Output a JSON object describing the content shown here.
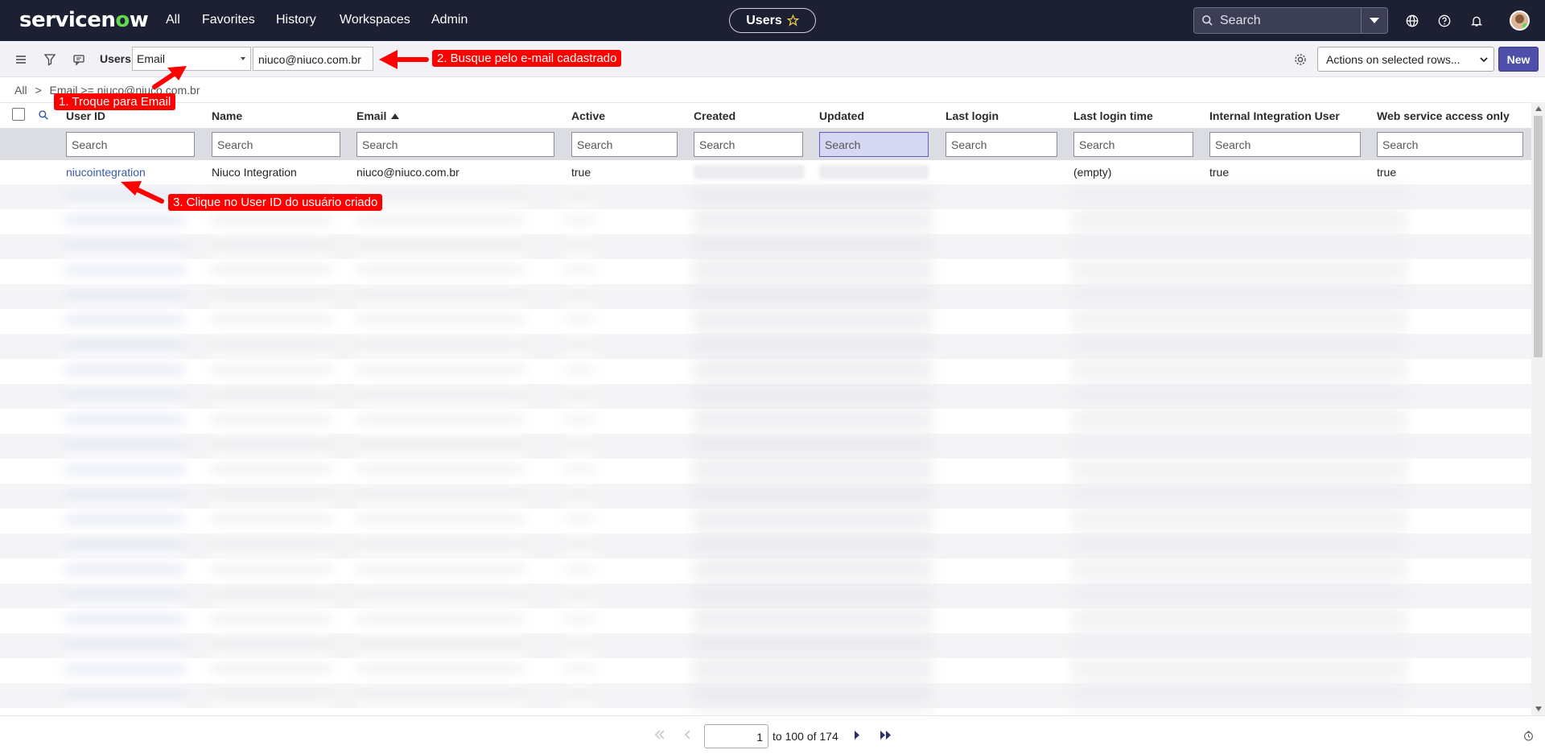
{
  "topbar": {
    "logo_text": "servicenow",
    "nav": [
      "All",
      "Favorites",
      "History",
      "Workspaces",
      "Admin"
    ],
    "context_pill": "Users",
    "search_label": "Search"
  },
  "toolbar": {
    "list_title": "Users",
    "field_select": "Email",
    "field_value": "niuco@niuco.com.br",
    "actions_select": "Actions on selected rows...",
    "new_button": "New"
  },
  "breadcrumb": {
    "all": "All",
    "separator": ">",
    "condition": "Email >= niuco@niuco.com.br"
  },
  "table": {
    "columns": [
      "User ID",
      "Name",
      "Email",
      "Active",
      "Created",
      "Updated",
      "Last login",
      "Last login time",
      "Internal Integration User",
      "Web service access only"
    ],
    "search_placeholder": "Search",
    "row": {
      "user_id": "niucointegration",
      "name": "Niuco Integration",
      "email": "niuco@niuco.com.br",
      "active": "true",
      "last_login_time": "(empty)",
      "internal_integration_user": "true",
      "web_service_access_only": "true"
    }
  },
  "pager": {
    "page_value": "1",
    "range_text": "to 100 of 174"
  },
  "annotations": {
    "step1": "1. Troque para Email",
    "step2": "2. Busque pelo e-mail cadastrado",
    "step3": "3. Clique no User ID do usuário criado"
  },
  "colors": {
    "topbar_bg": "#1d1f33",
    "accent": "#4d4fa8",
    "annotation": "#ff0000",
    "link": "#3559a8"
  }
}
